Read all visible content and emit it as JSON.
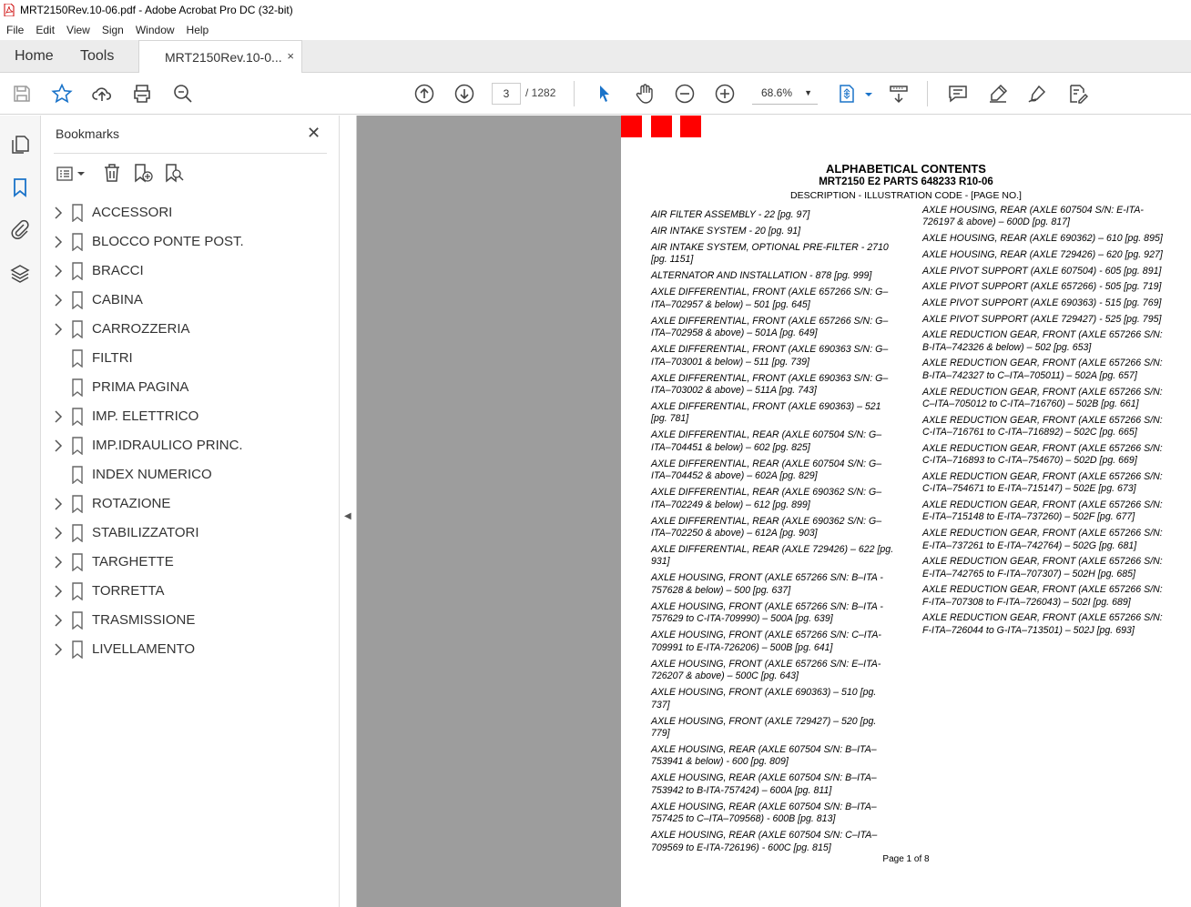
{
  "window": {
    "title": "MRT2150Rev.10-06.pdf - Adobe Acrobat Pro DC (32-bit)"
  },
  "menu": [
    "File",
    "Edit",
    "View",
    "Sign",
    "Window",
    "Help"
  ],
  "tabs": {
    "home": "Home",
    "tools": "Tools",
    "document": "MRT2150Rev.10-0...",
    "close": "×"
  },
  "toolbar": {
    "page_current": "3",
    "page_total": "/ 1282",
    "zoom": "68.6%",
    "icons": [
      "save-icon",
      "star-icon",
      "upload-icon",
      "print-icon",
      "search-zoom-icon",
      "page-up-icon",
      "page-down-icon",
      "select-cursor-icon",
      "hand-icon",
      "zoom-out-icon",
      "zoom-in-icon",
      "fit-page-icon",
      "scroll-mode-icon",
      "comment-icon",
      "highlight-icon",
      "sign-icon",
      "edit-icon"
    ]
  },
  "bookmarks": {
    "title": "Bookmarks",
    "close": "✕",
    "items": [
      {
        "label": "ACCESSORI",
        "expandable": true
      },
      {
        "label": "BLOCCO PONTE POST.",
        "expandable": true
      },
      {
        "label": "BRACCI",
        "expandable": true
      },
      {
        "label": "CABINA",
        "expandable": true
      },
      {
        "label": "CARROZZERIA",
        "expandable": true
      },
      {
        "label": "FILTRI",
        "expandable": false
      },
      {
        "label": "PRIMA PAGINA",
        "expandable": false
      },
      {
        "label": "IMP. ELETTRICO",
        "expandable": true
      },
      {
        "label": "IMP.IDRAULICO PRINC.",
        "expandable": true
      },
      {
        "label": "INDEX NUMERICO",
        "expandable": false
      },
      {
        "label": "ROTAZIONE",
        "expandable": true
      },
      {
        "label": "STABILIZZATORI",
        "expandable": true
      },
      {
        "label": "TARGHETTE",
        "expandable": true
      },
      {
        "label": "TORRETTA",
        "expandable": true
      },
      {
        "label": "TRASMISSIONE",
        "expandable": true
      },
      {
        "label": "LIVELLAMENTO",
        "expandable": true
      }
    ]
  },
  "document": {
    "heading": "ALPHABETICAL CONTENTS",
    "subheading": "MRT2150 E2 PARTS 648233 R10-06",
    "description": "DESCRIPTION - ILLUSTRATION CODE - [PAGE NO.]",
    "footer": "Page 1 of 8",
    "column1": [
      "AIR FILTER ASSEMBLY - 22 [pg. 97]",
      "AIR INTAKE SYSTEM - 20 [pg. 91]",
      "AIR INTAKE SYSTEM, OPTIONAL PRE-FILTER - 2710 [pg. 1151]",
      "ALTERNATOR AND INSTALLATION - 878 [pg. 999]",
      "AXLE DIFFERENTIAL, FRONT (AXLE 657266 S/N: G–ITA–702957 & below) – 501 [pg. 645]",
      "AXLE DIFFERENTIAL, FRONT (AXLE 657266 S/N: G–ITA–702958 & above) – 501A [pg. 649]",
      "AXLE DIFFERENTIAL, FRONT (AXLE 690363 S/N: G–ITA–703001 & below) – 511 [pg. 739]",
      "AXLE DIFFERENTIAL, FRONT (AXLE 690363 S/N: G–ITA–703002 & above) – 511A [pg. 743]",
      "AXLE DIFFERENTIAL, FRONT (AXLE 690363) – 521 [pg. 781]",
      "AXLE DIFFERENTIAL, REAR (AXLE 607504 S/N: G–ITA–704451 & below) – 602 [pg. 825]",
      "AXLE DIFFERENTIAL, REAR (AXLE 607504 S/N: G–ITA–704452 & above) – 602A [pg. 829]",
      "AXLE DIFFERENTIAL, REAR (AXLE 690362 S/N: G–ITA–702249 & below) – 612 [pg. 899]",
      "AXLE DIFFERENTIAL, REAR (AXLE 690362 S/N: G–ITA–702250 & above) – 612A [pg. 903]",
      "AXLE DIFFERENTIAL, REAR (AXLE 729426) – 622 [pg. 931]",
      "AXLE HOUSING, FRONT (AXLE 657266 S/N: B–ITA - 757628 & below) – 500 [pg. 637]",
      "AXLE HOUSING, FRONT (AXLE 657266 S/N: B–ITA - 757629 to C-ITA-709990) – 500A [pg. 639]",
      "AXLE HOUSING, FRONT (AXLE 657266 S/N: C–ITA-709991 to E-ITA-726206) – 500B [pg. 641]",
      "AXLE HOUSING, FRONT (AXLE 657266 S/N: E–ITA-726207 & above) – 500C [pg. 643]",
      "AXLE HOUSING, FRONT (AXLE 690363) – 510 [pg. 737]",
      "AXLE HOUSING, FRONT (AXLE 729427) – 520 [pg. 779]",
      "AXLE HOUSING, REAR (AXLE 607504 S/N: B–ITA–753941 & below) - 600 [pg. 809]",
      "AXLE HOUSING, REAR (AXLE 607504 S/N: B–ITA–753942 to B-ITA-757424) – 600A [pg. 811]",
      "AXLE HOUSING, REAR (AXLE 607504 S/N: B–ITA–757425 to C–ITA–709568) - 600B [pg. 813]",
      "AXLE HOUSING, REAR (AXLE 607504 S/N: C–ITA–709569 to E-ITA-726196) - 600C [pg. 815]"
    ],
    "column2": [
      "AXLE HOUSING, REAR (AXLE 607504 S/N: E-ITA-726197 & above) – 600D [pg. 817]",
      "AXLE HOUSING, REAR (AXLE 690362) – 610 [pg. 895]",
      "AXLE HOUSING, REAR (AXLE 729426) – 620 [pg. 927]",
      "AXLE PIVOT SUPPORT (AXLE 607504) - 605 [pg. 891]",
      "AXLE PIVOT SUPPORT (AXLE 657266) - 505 [pg. 719]",
      "AXLE PIVOT SUPPORT (AXLE 690363) - 515 [pg. 769]",
      "AXLE PIVOT SUPPORT (AXLE 729427) - 525 [pg. 795]",
      "AXLE REDUCTION GEAR, FRONT (AXLE 657266 S/N: B-ITA–742326 & below) – 502 [pg. 653]",
      "AXLE REDUCTION GEAR, FRONT (AXLE 657266 S/N: B-ITA–742327 to C–ITA–705011) – 502A [pg. 657]",
      "AXLE REDUCTION GEAR, FRONT (AXLE 657266 S/N: C–ITA–705012 to C-ITA–716760) – 502B [pg. 661]",
      "AXLE REDUCTION GEAR, FRONT (AXLE 657266 S/N: C-ITA–716761 to C-ITA–716892) – 502C [pg. 665]",
      "AXLE REDUCTION GEAR, FRONT (AXLE 657266 S/N: C-ITA–716893 to C-ITA–754670) – 502D [pg. 669]",
      "AXLE REDUCTION GEAR, FRONT (AXLE 657266 S/N: C-ITA–754671 to E-ITA–715147) – 502E [pg. 673]",
      "AXLE REDUCTION GEAR, FRONT (AXLE 657266 S/N: E-ITA–715148 to E-ITA–737260) – 502F [pg. 677]",
      "AXLE REDUCTION GEAR, FRONT (AXLE 657266 S/N: E-ITA–737261 to E-ITA–742764) – 502G [pg. 681]",
      "AXLE REDUCTION GEAR, FRONT (AXLE 657266 S/N: E-ITA–742765 to F-ITA–707307) – 502H [pg. 685]",
      "AXLE REDUCTION GEAR, FRONT (AXLE 657266 S/N: F-ITA–707308 to F-ITA–726043) – 502I [pg. 689]",
      "AXLE REDUCTION GEAR, FRONT (AXLE 657266 S/N: F-ITA–726044 to G-ITA–713501) – 502J [pg. 693]"
    ]
  }
}
